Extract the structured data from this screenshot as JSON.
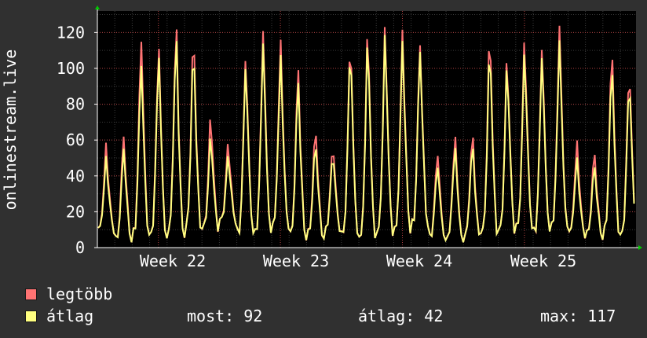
{
  "chart_data": {
    "type": "line",
    "title": "",
    "ylabel": "onlinestream.live",
    "ylim": [
      0,
      132
    ],
    "yticks": [
      0,
      20,
      40,
      60,
      80,
      100,
      120
    ],
    "x_labels": [
      "Week 22",
      "Week 23",
      "Week 24",
      "Week 25"
    ],
    "grid": true,
    "background": "#000000",
    "series": [
      {
        "name": "legtöbb",
        "color": "#ff7373",
        "daily_peaks": [
          57,
          64,
          119,
          113,
          122,
          120,
          74,
          59,
          107,
          122,
          115,
          100,
          67,
          59,
          117,
          121,
          121,
          121,
          116,
          55,
          63,
          64,
          121,
          107,
          116,
          113,
          124,
          59,
          54,
          110,
          101
        ],
        "daily_lows": [
          11,
          5,
          9,
          8,
          10,
          12,
          11,
          15,
          9,
          10,
          14,
          8,
          8,
          10,
          8,
          6,
          9,
          11,
          14,
          6,
          6,
          7,
          9,
          10,
          12,
          10,
          14,
          9,
          8,
          10,
          8
        ]
      },
      {
        "name": "átlag",
        "color": "#ffff80",
        "daily_peaks": [
          50,
          57,
          105,
          108,
          116,
          112,
          63,
          52,
          102,
          115,
          107,
          93,
          59,
          54,
          113,
          116,
          117,
          115,
          112,
          48,
          57,
          58,
          113,
          103,
          109,
          108,
          116,
          50,
          47,
          101,
          95
        ],
        "daily_lows": [
          11,
          5,
          9,
          8,
          10,
          12,
          11,
          15,
          9,
          10,
          14,
          8,
          8,
          10,
          8,
          6,
          9,
          11,
          14,
          6,
          6,
          7,
          9,
          10,
          12,
          10,
          14,
          9,
          8,
          10,
          8
        ]
      }
    ]
  },
  "legend": [
    {
      "label": "legtöbb",
      "color": "#ff7373"
    },
    {
      "label": "átlag",
      "color": "#ffff80"
    }
  ],
  "stats": {
    "now": "most: 92",
    "avg": "átlag: 42",
    "max": "max: 117"
  }
}
